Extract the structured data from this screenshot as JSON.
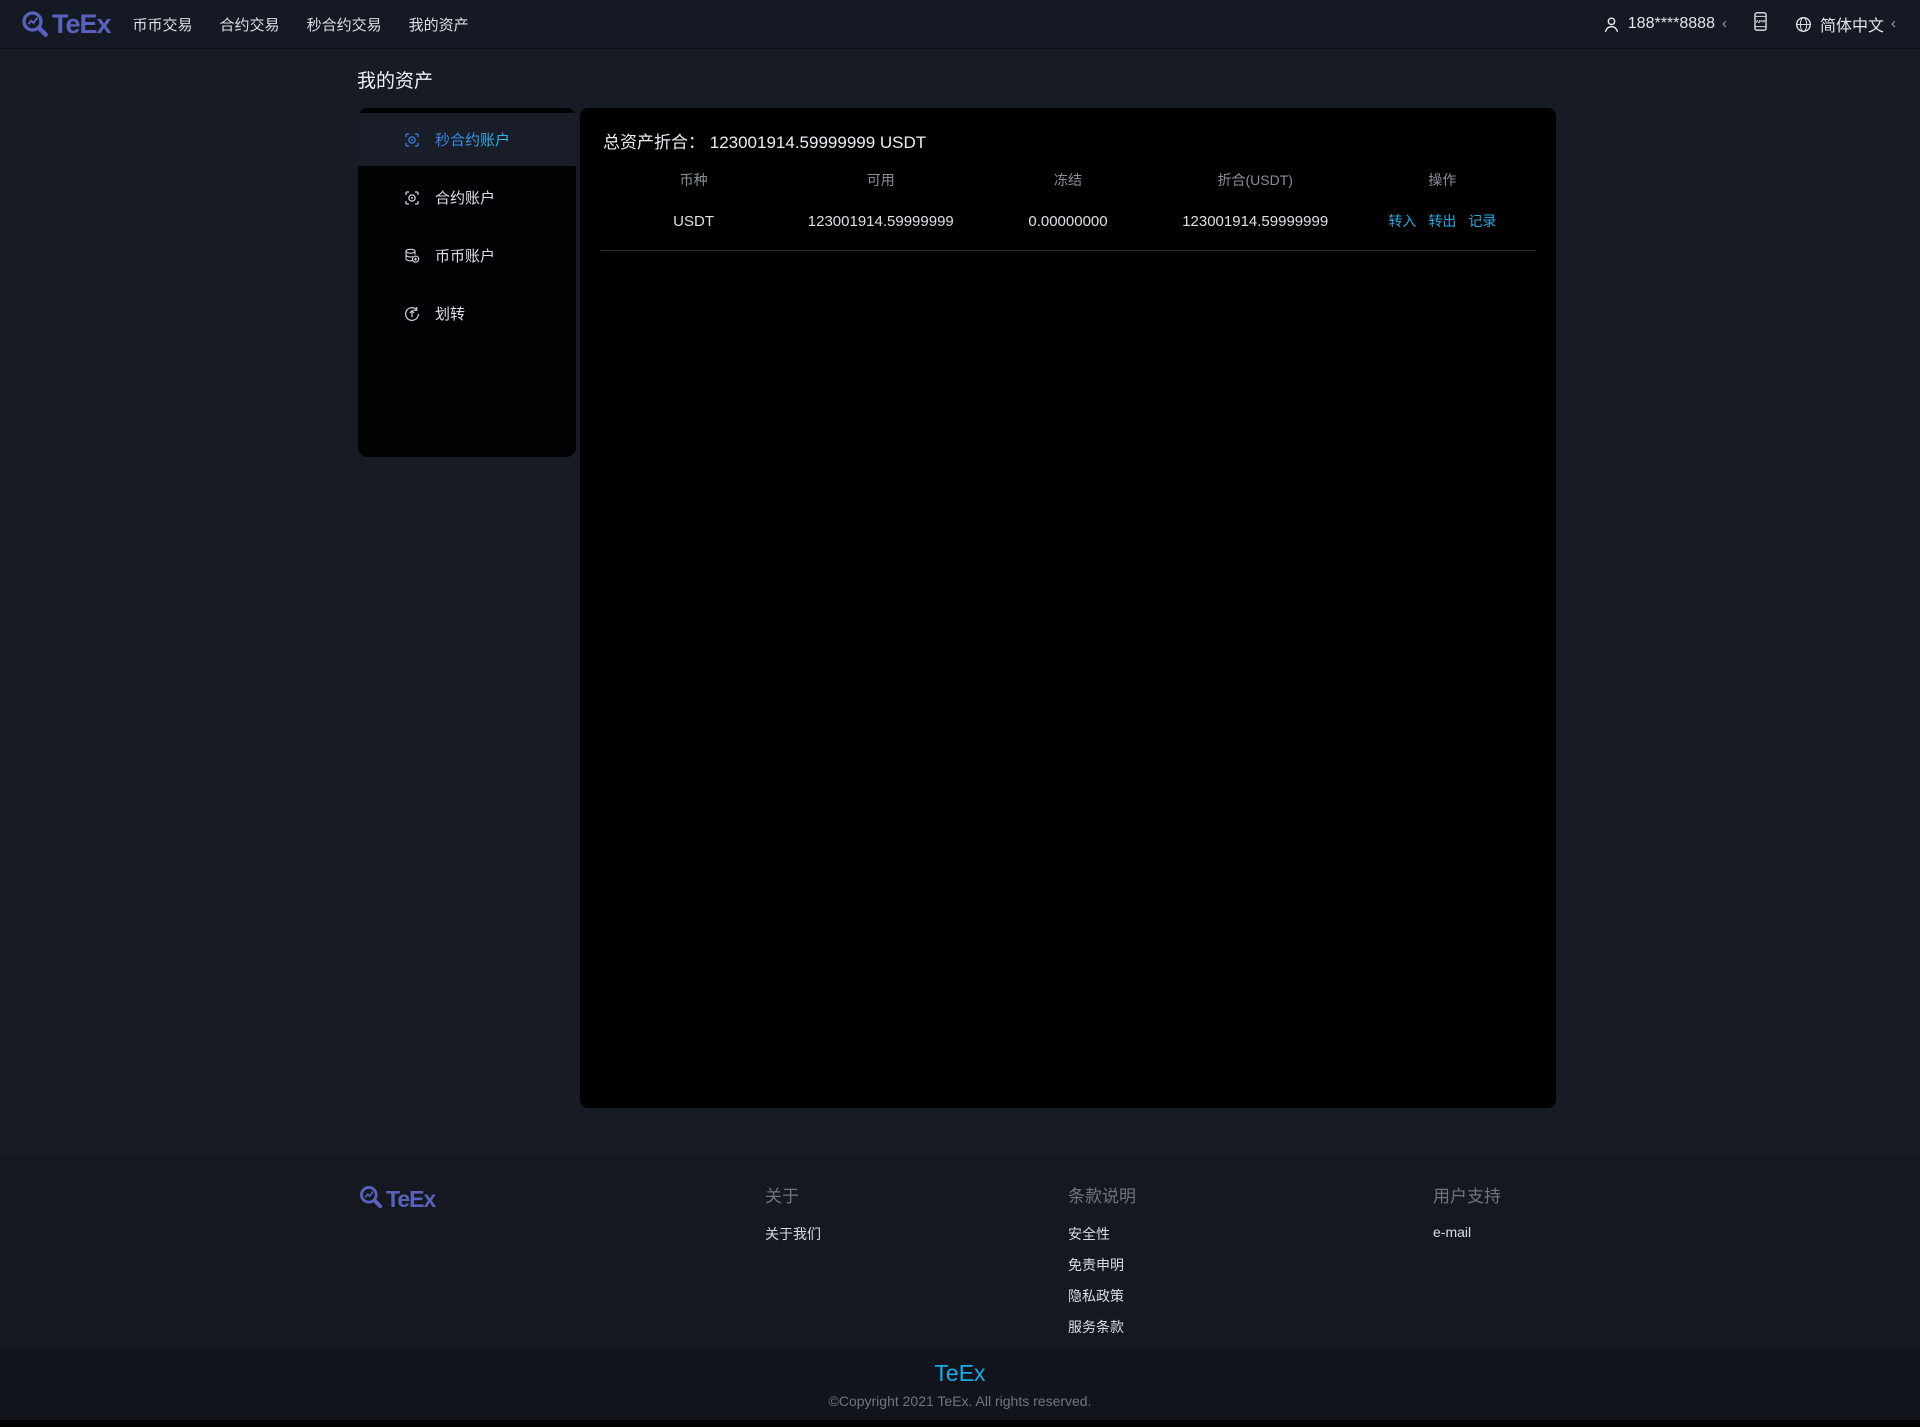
{
  "brand": {
    "name": "TeEx",
    "color": "#5a62bd",
    "accent": "#29a7e4"
  },
  "nav": {
    "items": [
      "币币交易",
      "合约交易",
      "秒合约交易",
      "我的资产"
    ],
    "user": {
      "phone": "188****8888",
      "chevron": "‹"
    },
    "language": {
      "label": "简体中文",
      "chevron": "‹"
    }
  },
  "page": {
    "title": "我的资产"
  },
  "sidebar": {
    "items": [
      {
        "label": "秒合约账户",
        "icon": "seconds-contract-account-icon",
        "active": true
      },
      {
        "label": "合约账户",
        "icon": "contract-account-icon",
        "active": false
      },
      {
        "label": "币币账户",
        "icon": "spot-account-icon",
        "active": false
      },
      {
        "label": "划转",
        "icon": "transfer-icon",
        "active": false
      }
    ]
  },
  "assets": {
    "total_label": "总资产折合：",
    "total_value": "123001914.59999999 USDT",
    "table": {
      "headers": [
        "币种",
        "可用",
        "冻结",
        "折合(USDT)",
        "操作"
      ],
      "rows": [
        {
          "currency": "USDT",
          "available": "123001914.59999999",
          "frozen": "0.00000000",
          "converted": "123001914.59999999",
          "actions": [
            "转入",
            "转出",
            "记录"
          ]
        }
      ]
    }
  },
  "footer": {
    "columns": [
      {
        "title": "关于",
        "links": [
          "关于我们"
        ]
      },
      {
        "title": "条款说明",
        "links": [
          "安全性",
          "免责申明",
          "隐私政策",
          "服务条款"
        ]
      },
      {
        "title": "用户支持",
        "links": [
          "e-mail"
        ]
      }
    ],
    "brand": "TeEx",
    "copyright": "©Copyright 2021 TeEx. All rights reserved."
  }
}
